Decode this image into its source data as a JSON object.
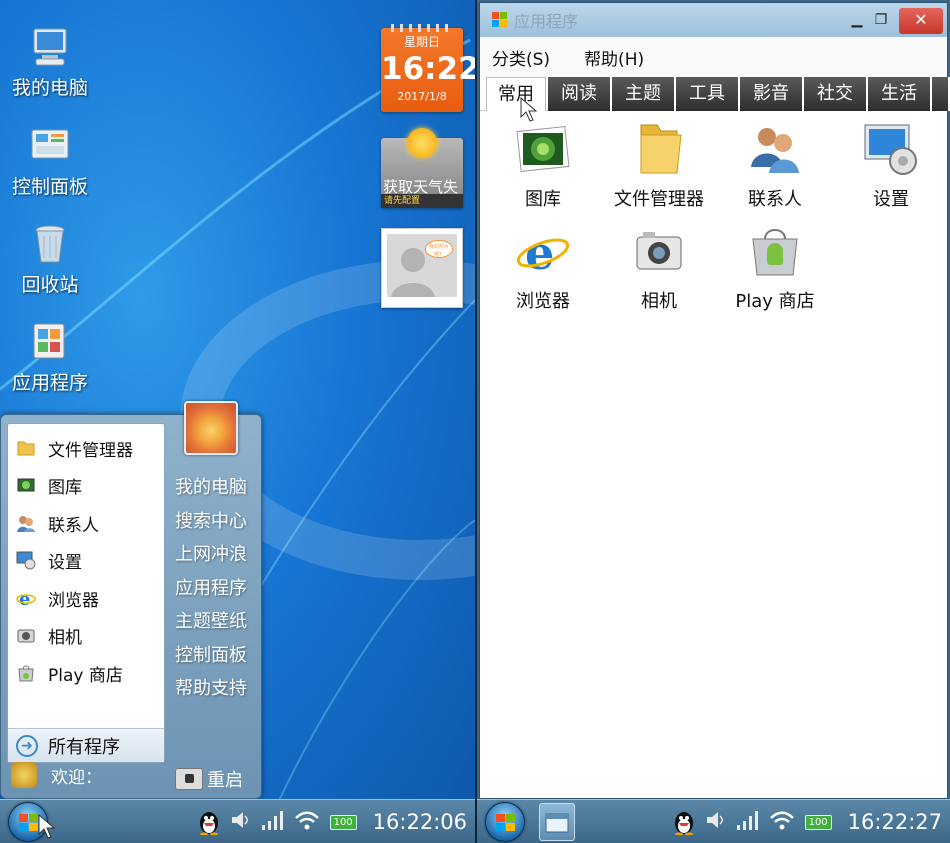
{
  "left": {
    "desktop_icons": [
      {
        "label": "我的电脑",
        "icon": "computer-icon"
      },
      {
        "label": "控制面板",
        "icon": "control-panel-icon"
      },
      {
        "label": "回收站",
        "icon": "recycle-bin-icon"
      },
      {
        "label": "应用程序",
        "icon": "applications-icon"
      }
    ],
    "calendar": {
      "weekday": "星期日",
      "time": "16:22",
      "date": "2017/1/8"
    },
    "weather": {
      "title": "获取天气失",
      "subtitle": "请先配置"
    },
    "photo_bubble": "我的照片呢？",
    "start_menu": {
      "programs": [
        {
          "label": "文件管理器",
          "icon": "folder-icon"
        },
        {
          "label": "图库",
          "icon": "gallery-icon"
        },
        {
          "label": "联系人",
          "icon": "contacts-icon"
        },
        {
          "label": "设置",
          "icon": "settings-icon"
        },
        {
          "label": "浏览器",
          "icon": "browser-icon"
        },
        {
          "label": "相机",
          "icon": "camera-icon"
        },
        {
          "label": "Play 商店",
          "icon": "play-store-icon"
        }
      ],
      "all_programs": "所有程序",
      "right_links": [
        "我的电脑",
        "搜索中心",
        "上网冲浪",
        "应用程序",
        "主题壁纸",
        "控制面板",
        "帮助支持"
      ],
      "welcome": "欢迎：",
      "restart": "重启"
    },
    "taskbar": {
      "battery": "100",
      "clock": "16:22:06"
    }
  },
  "right": {
    "window": {
      "title": "应用程序",
      "close_glyph": "✕",
      "menu": [
        "分类(S)",
        "帮助(H)"
      ],
      "tabs": [
        "常用",
        "阅读",
        "主题",
        "工具",
        "影音",
        "社交",
        "生活"
      ],
      "active_tab": "常用",
      "apps": [
        {
          "label": "图库",
          "icon": "gallery-icon"
        },
        {
          "label": "文件管理器",
          "icon": "folder-icon"
        },
        {
          "label": "联系人",
          "icon": "contacts-icon"
        },
        {
          "label": "设置",
          "icon": "settings-icon"
        },
        {
          "label": "浏览器",
          "icon": "browser-icon"
        },
        {
          "label": "相机",
          "icon": "camera-icon"
        },
        {
          "label": "Play 商店",
          "icon": "play-store-icon"
        }
      ]
    },
    "taskbar": {
      "battery": "100",
      "clock": "16:22:27"
    }
  },
  "colors": {
    "desktop": "#1776d4",
    "start_menu": "#7fa3c0",
    "calendar": "#f06a1c",
    "taskbar": "#4a7698",
    "close_button": "#d4483b"
  }
}
